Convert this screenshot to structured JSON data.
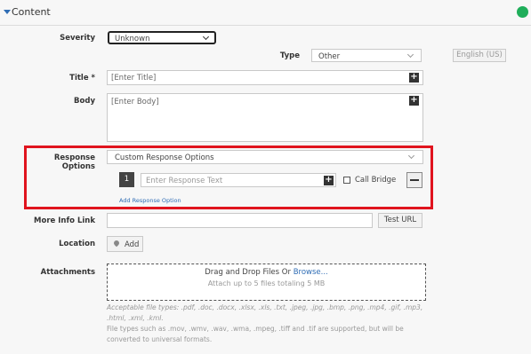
{
  "section": {
    "title": "Content"
  },
  "severity": {
    "label": "Severity",
    "value": "Unknown"
  },
  "type": {
    "label": "Type",
    "value": "Other"
  },
  "language": {
    "value": "English (US)"
  },
  "title_field": {
    "label": "Title *",
    "placeholder": "[Enter Title]"
  },
  "body_field": {
    "label": "Body",
    "placeholder": "[Enter Body]"
  },
  "response_options": {
    "label": "Response Options",
    "select_value": "Custom Response Options",
    "row_number": "1",
    "response_placeholder": "Enter Response Text",
    "call_bridge_label": "Call Bridge",
    "add_link": "Add Response Option",
    "highlight_color": "#e0141e"
  },
  "more_info": {
    "label": "More Info Link",
    "test_button": "Test URL"
  },
  "location": {
    "label": "Location",
    "add_button": "Add"
  },
  "attachments": {
    "label": "Attachments",
    "drop_text": "Drag and Drop Files Or",
    "browse_link": "Browse...",
    "limit_text": "Attach up to 5 files totaling 5 MB",
    "acceptable_line1": "Acceptable file types: .pdf, .doc, .docx, .xlsx, .xls, .txt, .jpeg, .jpg, .bmp, .png, .mp4, .gif, .mp3,",
    "acceptable_line2": ".html, .xml, .kml.",
    "conversion_line1": "File types such as .mov, .wmv, .wav, .wma, .mpeg, .tiff and .tif are supported, but will be",
    "conversion_line2": "converted to universal formats."
  },
  "colors": {
    "accent": "#2f6db5",
    "status_green": "#1fae5a"
  }
}
